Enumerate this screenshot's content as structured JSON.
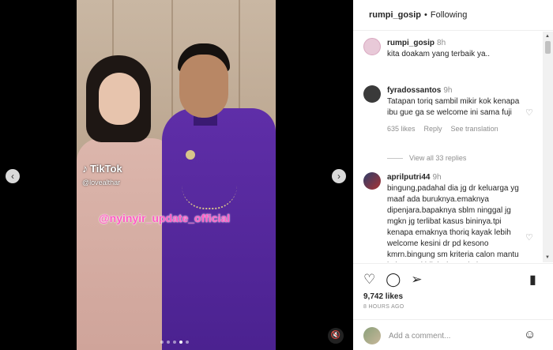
{
  "post": {
    "header": {
      "username": "rumpi_gosip",
      "separator": "•",
      "follow_status": "Following"
    },
    "media": {
      "tiktok_label": "TikTok",
      "tiktok_handle": "@lovealthar",
      "watermark": "@nyinyir_update_official",
      "carousel_dots": 5,
      "active_dot": 4
    },
    "caption": {
      "username": "rumpi_gosip",
      "time": "8h",
      "text": "kita doakam yang terbaik ya.."
    },
    "comments": [
      {
        "username": "fyradossantos",
        "time": "9h",
        "text": "Tatapan toriq sambil mikir kok kenapa ibu gue ga se welcome ini sama fuji",
        "likes": "635 likes",
        "reply_label": "Reply",
        "translate_label": "See translation",
        "view_replies": "View all 33 replies"
      },
      {
        "username": "aprilputri44",
        "time": "9h",
        "text": "bingung,padahal dia jg dr keluarga yg maaf ada buruknya.emaknya dipenjara.bapaknya sblm ninggal jg mgkn jg terlibat kasus bininya.tpi kenapa emaknya thoriq kayak lebih welcome kesini dr pd kesono kmrn.bingung sm kriteria calon mantu kalau soal hijab dan pakain"
      }
    ],
    "actions": {
      "likes": "9,742 likes",
      "posted": "8 HOURS AGO"
    },
    "add_comment": {
      "placeholder": "Add a comment..."
    }
  },
  "icons": {
    "prev": "chevron-left-icon",
    "next": "chevron-right-icon",
    "mute": "speaker-muted-icon",
    "heart": "heart-icon",
    "comment": "comment-icon",
    "share": "share-icon",
    "bookmark": "bookmark-icon",
    "emoji": "smiley-icon"
  },
  "colors": {
    "watermark": "#ff5bc4",
    "suit": "#5f2ea8"
  }
}
